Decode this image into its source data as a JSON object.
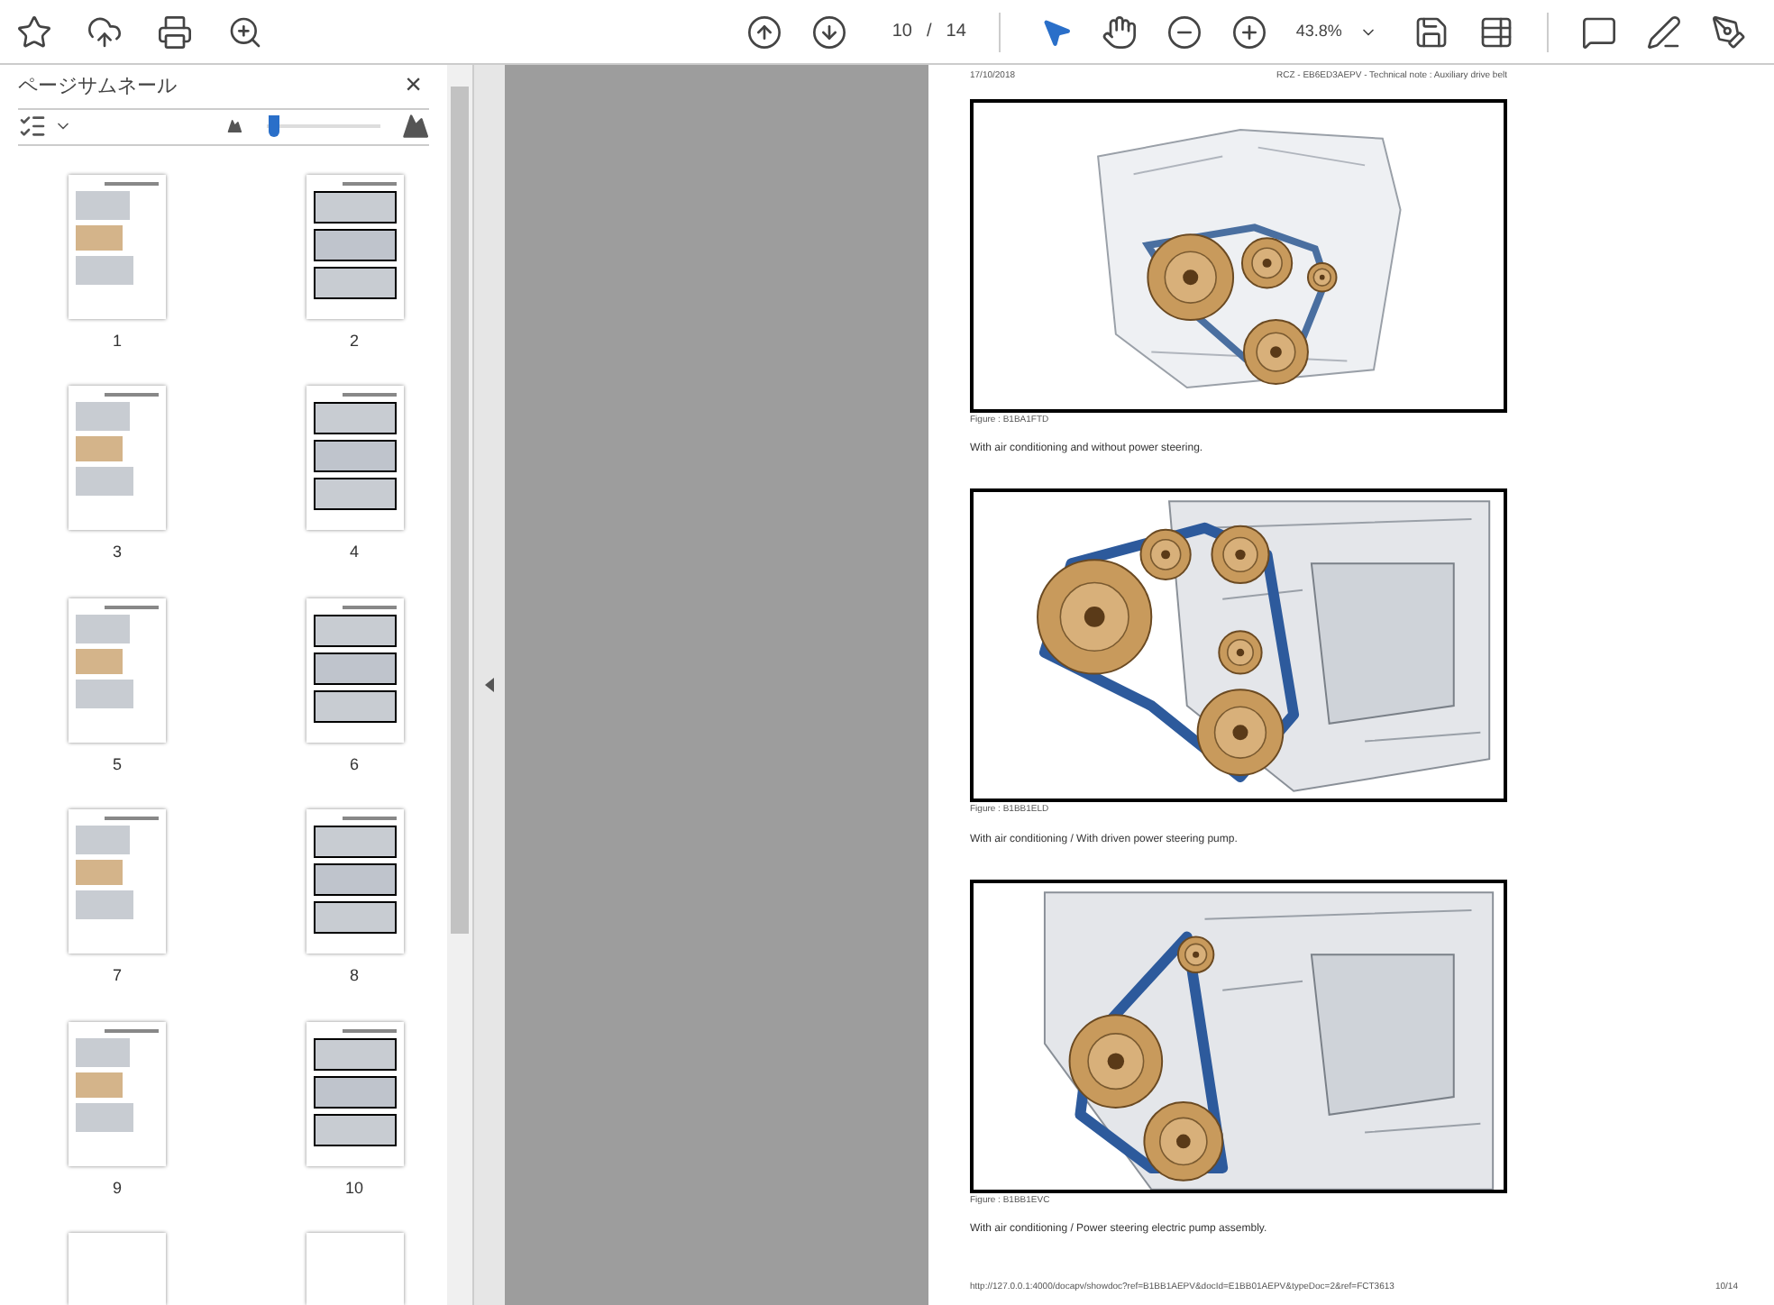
{
  "toolbar": {
    "page_current": "10",
    "page_separator": "/",
    "page_total": "14",
    "zoom": "43.8%"
  },
  "sidebar": {
    "title": "ページサムネール",
    "close": "×",
    "thumb_size": {
      "level": 0.06
    },
    "thumbnails": [
      {
        "label": "1",
        "selected": false
      },
      {
        "label": "2",
        "selected": false
      },
      {
        "label": "3",
        "selected": false
      },
      {
        "label": "4",
        "selected": false
      },
      {
        "label": "5",
        "selected": false
      },
      {
        "label": "6",
        "selected": false
      },
      {
        "label": "7",
        "selected": false
      },
      {
        "label": "8",
        "selected": false
      },
      {
        "label": "9",
        "selected": false
      },
      {
        "label": "10",
        "selected": false
      }
    ]
  },
  "document": {
    "header_left": "17/10/2018",
    "header_right": "RCZ - EB6ED3AEPV - Technical note : Auxiliary drive belt",
    "figures": [
      {
        "kind": "diagram",
        "caption": "Figure : B1BA1FTD",
        "description": "With air conditioning and without power steering."
      },
      {
        "kind": "engine",
        "caption": "Figure : B1BB1ELD",
        "description": "With air conditioning / With driven power steering pump."
      },
      {
        "kind": "engine2",
        "caption": "Figure : B1BB1EVC",
        "description": "With air conditioning / Power steering electric pump assembly."
      }
    ],
    "footer_url": "http://127.0.0.1:4000/docapv/showdoc?ref=B1BB1AEPV&docId=E1BB01AEPV&typeDoc=2&ref=FCT3613",
    "footer_page": "10/14"
  }
}
